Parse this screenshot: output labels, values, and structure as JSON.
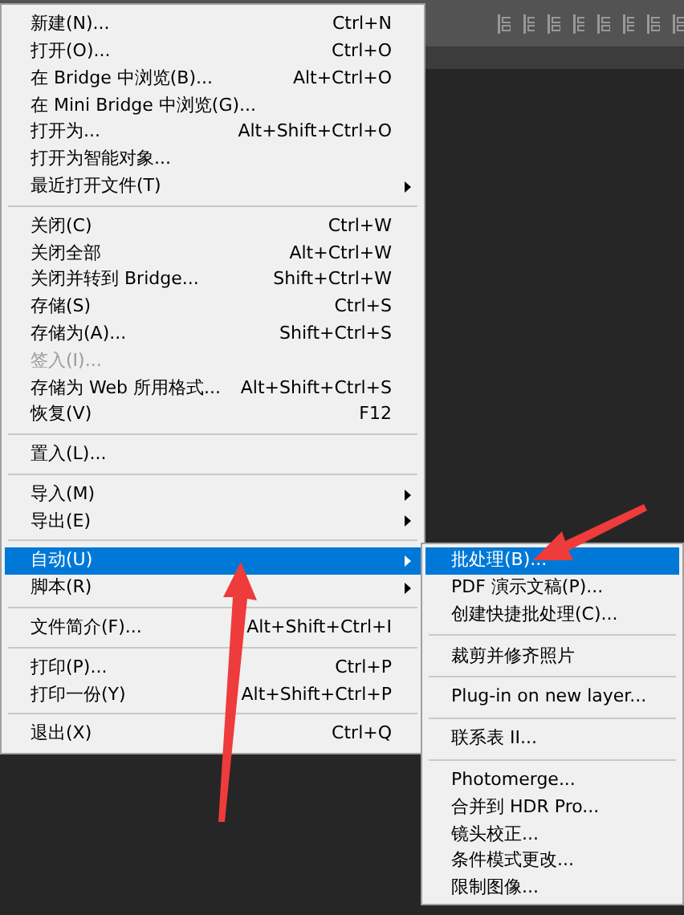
{
  "menu": {
    "items": [
      {
        "kind": "item",
        "label": "新建(N)...",
        "shortcut": "Ctrl+N",
        "has_submenu": false,
        "disabled": false,
        "selected": false
      },
      {
        "kind": "item",
        "label": "打开(O)...",
        "shortcut": "Ctrl+O",
        "has_submenu": false,
        "disabled": false,
        "selected": false
      },
      {
        "kind": "item",
        "label": "在 Bridge 中浏览(B)...",
        "shortcut": "Alt+Ctrl+O",
        "has_submenu": false,
        "disabled": false,
        "selected": false
      },
      {
        "kind": "item",
        "label": "在 Mini Bridge 中浏览(G)...",
        "has_submenu": false,
        "disabled": false,
        "selected": false
      },
      {
        "kind": "item",
        "label": "打开为...",
        "shortcut": "Alt+Shift+Ctrl+O",
        "has_submenu": false,
        "disabled": false,
        "selected": false
      },
      {
        "kind": "item",
        "label": "打开为智能对象...",
        "has_submenu": false,
        "disabled": false,
        "selected": false
      },
      {
        "kind": "item",
        "label": "最近打开文件(T)",
        "has_submenu": true,
        "disabled": false,
        "selected": false
      },
      {
        "kind": "separator"
      },
      {
        "kind": "item",
        "label": "关闭(C)",
        "shortcut": "Ctrl+W",
        "has_submenu": false,
        "disabled": false,
        "selected": false
      },
      {
        "kind": "item",
        "label": "关闭全部",
        "shortcut": "Alt+Ctrl+W",
        "has_submenu": false,
        "disabled": false,
        "selected": false
      },
      {
        "kind": "item",
        "label": "关闭并转到 Bridge...",
        "shortcut": "Shift+Ctrl+W",
        "has_submenu": false,
        "disabled": false,
        "selected": false
      },
      {
        "kind": "item",
        "label": "存储(S)",
        "shortcut": "Ctrl+S",
        "has_submenu": false,
        "disabled": false,
        "selected": false
      },
      {
        "kind": "item",
        "label": "存储为(A)...",
        "shortcut": "Shift+Ctrl+S",
        "has_submenu": false,
        "disabled": false,
        "selected": false
      },
      {
        "kind": "item",
        "label": "签入(I)...",
        "has_submenu": false,
        "disabled": true,
        "selected": false
      },
      {
        "kind": "item",
        "label": "存储为 Web 所用格式...",
        "shortcut": "Alt+Shift+Ctrl+S",
        "has_submenu": false,
        "disabled": false,
        "selected": false
      },
      {
        "kind": "item",
        "label": "恢复(V)",
        "shortcut": "F12",
        "has_submenu": false,
        "disabled": false,
        "selected": false
      },
      {
        "kind": "separator"
      },
      {
        "kind": "item",
        "label": "置入(L)...",
        "has_submenu": false,
        "disabled": false,
        "selected": false
      },
      {
        "kind": "separator"
      },
      {
        "kind": "item",
        "label": "导入(M)",
        "has_submenu": true,
        "disabled": false,
        "selected": false
      },
      {
        "kind": "item",
        "label": "导出(E)",
        "has_submenu": true,
        "disabled": false,
        "selected": false
      },
      {
        "kind": "separator"
      },
      {
        "kind": "item",
        "label": "自动(U)",
        "has_submenu": true,
        "disabled": false,
        "selected": true
      },
      {
        "kind": "item",
        "label": "脚本(R)",
        "has_submenu": true,
        "disabled": false,
        "selected": false
      },
      {
        "kind": "separator"
      },
      {
        "kind": "item",
        "label": "文件简介(F)...",
        "shortcut": "Alt+Shift+Ctrl+I",
        "has_submenu": false,
        "disabled": false,
        "selected": false
      },
      {
        "kind": "separator"
      },
      {
        "kind": "item",
        "label": "打印(P)...",
        "shortcut": "Ctrl+P",
        "has_submenu": false,
        "disabled": false,
        "selected": false
      },
      {
        "kind": "item",
        "label": "打印一份(Y)",
        "shortcut": "Alt+Shift+Ctrl+P",
        "has_submenu": false,
        "disabled": false,
        "selected": false
      },
      {
        "kind": "separator"
      },
      {
        "kind": "item",
        "label": "退出(X)",
        "shortcut": "Ctrl+Q",
        "has_submenu": false,
        "disabled": false,
        "selected": false
      }
    ]
  },
  "submenu": {
    "items": [
      {
        "kind": "item",
        "label": "批处理(B)...",
        "selected": true
      },
      {
        "kind": "item",
        "label": "PDF 演示文稿(P)...",
        "selected": false
      },
      {
        "kind": "item",
        "label": "创建快捷批处理(C)...",
        "selected": false
      },
      {
        "kind": "separator"
      },
      {
        "kind": "item",
        "label": "裁剪并修齐照片",
        "selected": false
      },
      {
        "kind": "separator"
      },
      {
        "kind": "item",
        "label": "Plug-in on new layer...",
        "selected": false
      },
      {
        "kind": "separator"
      },
      {
        "kind": "item",
        "label": "联系表 II...",
        "selected": false
      },
      {
        "kind": "separator"
      },
      {
        "kind": "item",
        "label": "Photomerge...",
        "selected": false
      },
      {
        "kind": "item",
        "label": "合并到 HDR Pro...",
        "selected": false
      },
      {
        "kind": "item",
        "label": "镜头校正...",
        "selected": false
      },
      {
        "kind": "item",
        "label": "条件模式更改...",
        "selected": false
      },
      {
        "kind": "item",
        "label": "限制图像...",
        "selected": false
      }
    ]
  }
}
